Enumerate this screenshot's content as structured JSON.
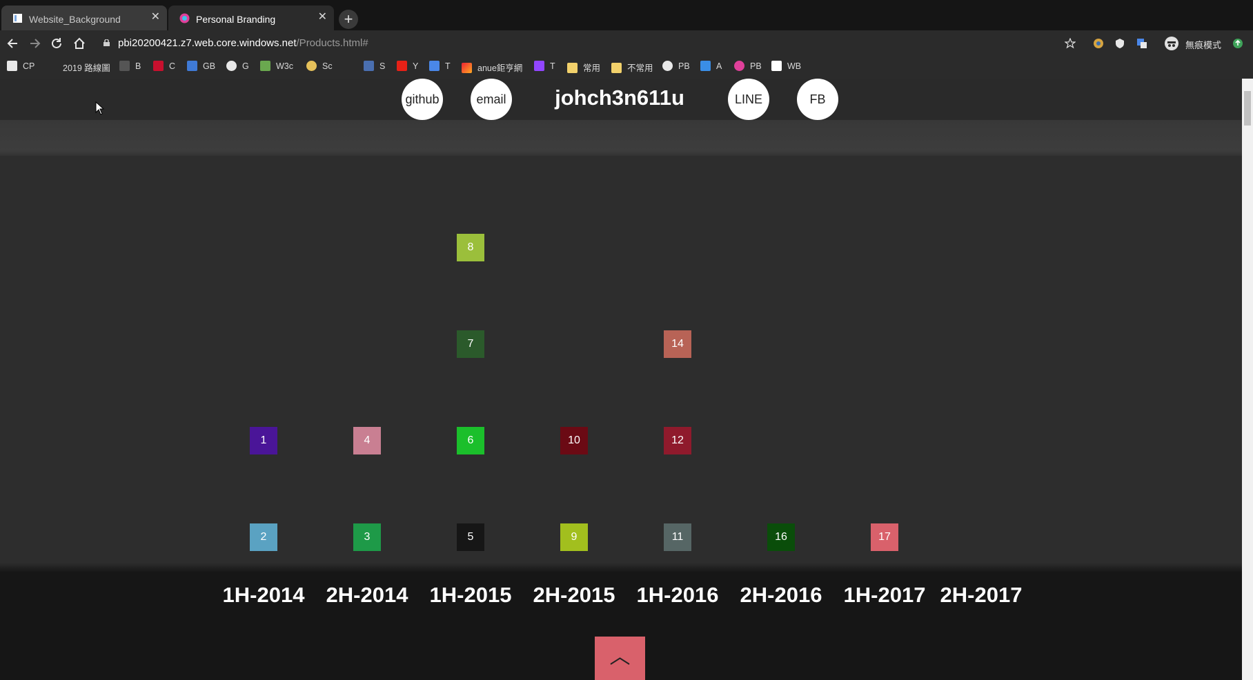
{
  "browser": {
    "tabs": [
      {
        "title": "Website_Background",
        "close": "✕"
      },
      {
        "title": "Personal Branding",
        "close": "✕"
      }
    ],
    "new_tab": "+",
    "url_main": "pbi20200421.z7.web.core.windows.net",
    "url_path": "/Products.html#",
    "profile_label": "無痕模式",
    "bookmarks": [
      "CP",
      "2019 路線圖",
      "B",
      "C",
      "GB",
      "G",
      "W3c",
      "Sc",
      "S",
      "Y",
      "T",
      "anue鉅亨網",
      "T",
      "常用",
      "不常用",
      "PB",
      "A",
      "PB",
      "WB"
    ],
    "colors": {
      "tab_active": "#2b2b2b",
      "toolbar": "#2b2b2b"
    }
  },
  "header": {
    "links": [
      "github",
      "email",
      "LINE",
      "FB"
    ],
    "title": "johch3n611u"
  },
  "timeline": {
    "periods": [
      "1H-2014",
      "2H-2014",
      "1H-2015",
      "2H-2015",
      "1H-2016",
      "2H-2016",
      "1H-2017",
      "2H-2017"
    ],
    "items": [
      {
        "label": "8",
        "period": "1H-2015",
        "color": "#9bbf3b"
      },
      {
        "label": "7",
        "period": "1H-2015",
        "color": "#2b5a2b"
      },
      {
        "label": "14",
        "period": "1H-2016",
        "color": "#b86356"
      },
      {
        "label": "1",
        "period": "1H-2014",
        "color": "#4a1598"
      },
      {
        "label": "4",
        "period": "2H-2014",
        "color": "#c97f92"
      },
      {
        "label": "6",
        "period": "1H-2015",
        "color": "#1bbf2b"
      },
      {
        "label": "10",
        "period": "2H-2015",
        "color": "#6b0a14"
      },
      {
        "label": "12",
        "period": "1H-2016",
        "color": "#8f1a2c"
      },
      {
        "label": "2",
        "period": "1H-2014",
        "color": "#5aa2c2"
      },
      {
        "label": "3",
        "period": "2H-2014",
        "color": "#1e9a48"
      },
      {
        "label": "5",
        "period": "1H-2015",
        "color": "#161616"
      },
      {
        "label": "9",
        "period": "2H-2015",
        "color": "#a2bf1e"
      },
      {
        "label": "11",
        "period": "1H-2016",
        "color": "#566665"
      },
      {
        "label": "16",
        "period": "2H-2016",
        "color": "#0a4d0a"
      },
      {
        "label": "17",
        "period": "1H-2017",
        "color": "#d9616b"
      }
    ],
    "top_button": "︿",
    "colors": {
      "top_button": "#d9616b"
    }
  }
}
